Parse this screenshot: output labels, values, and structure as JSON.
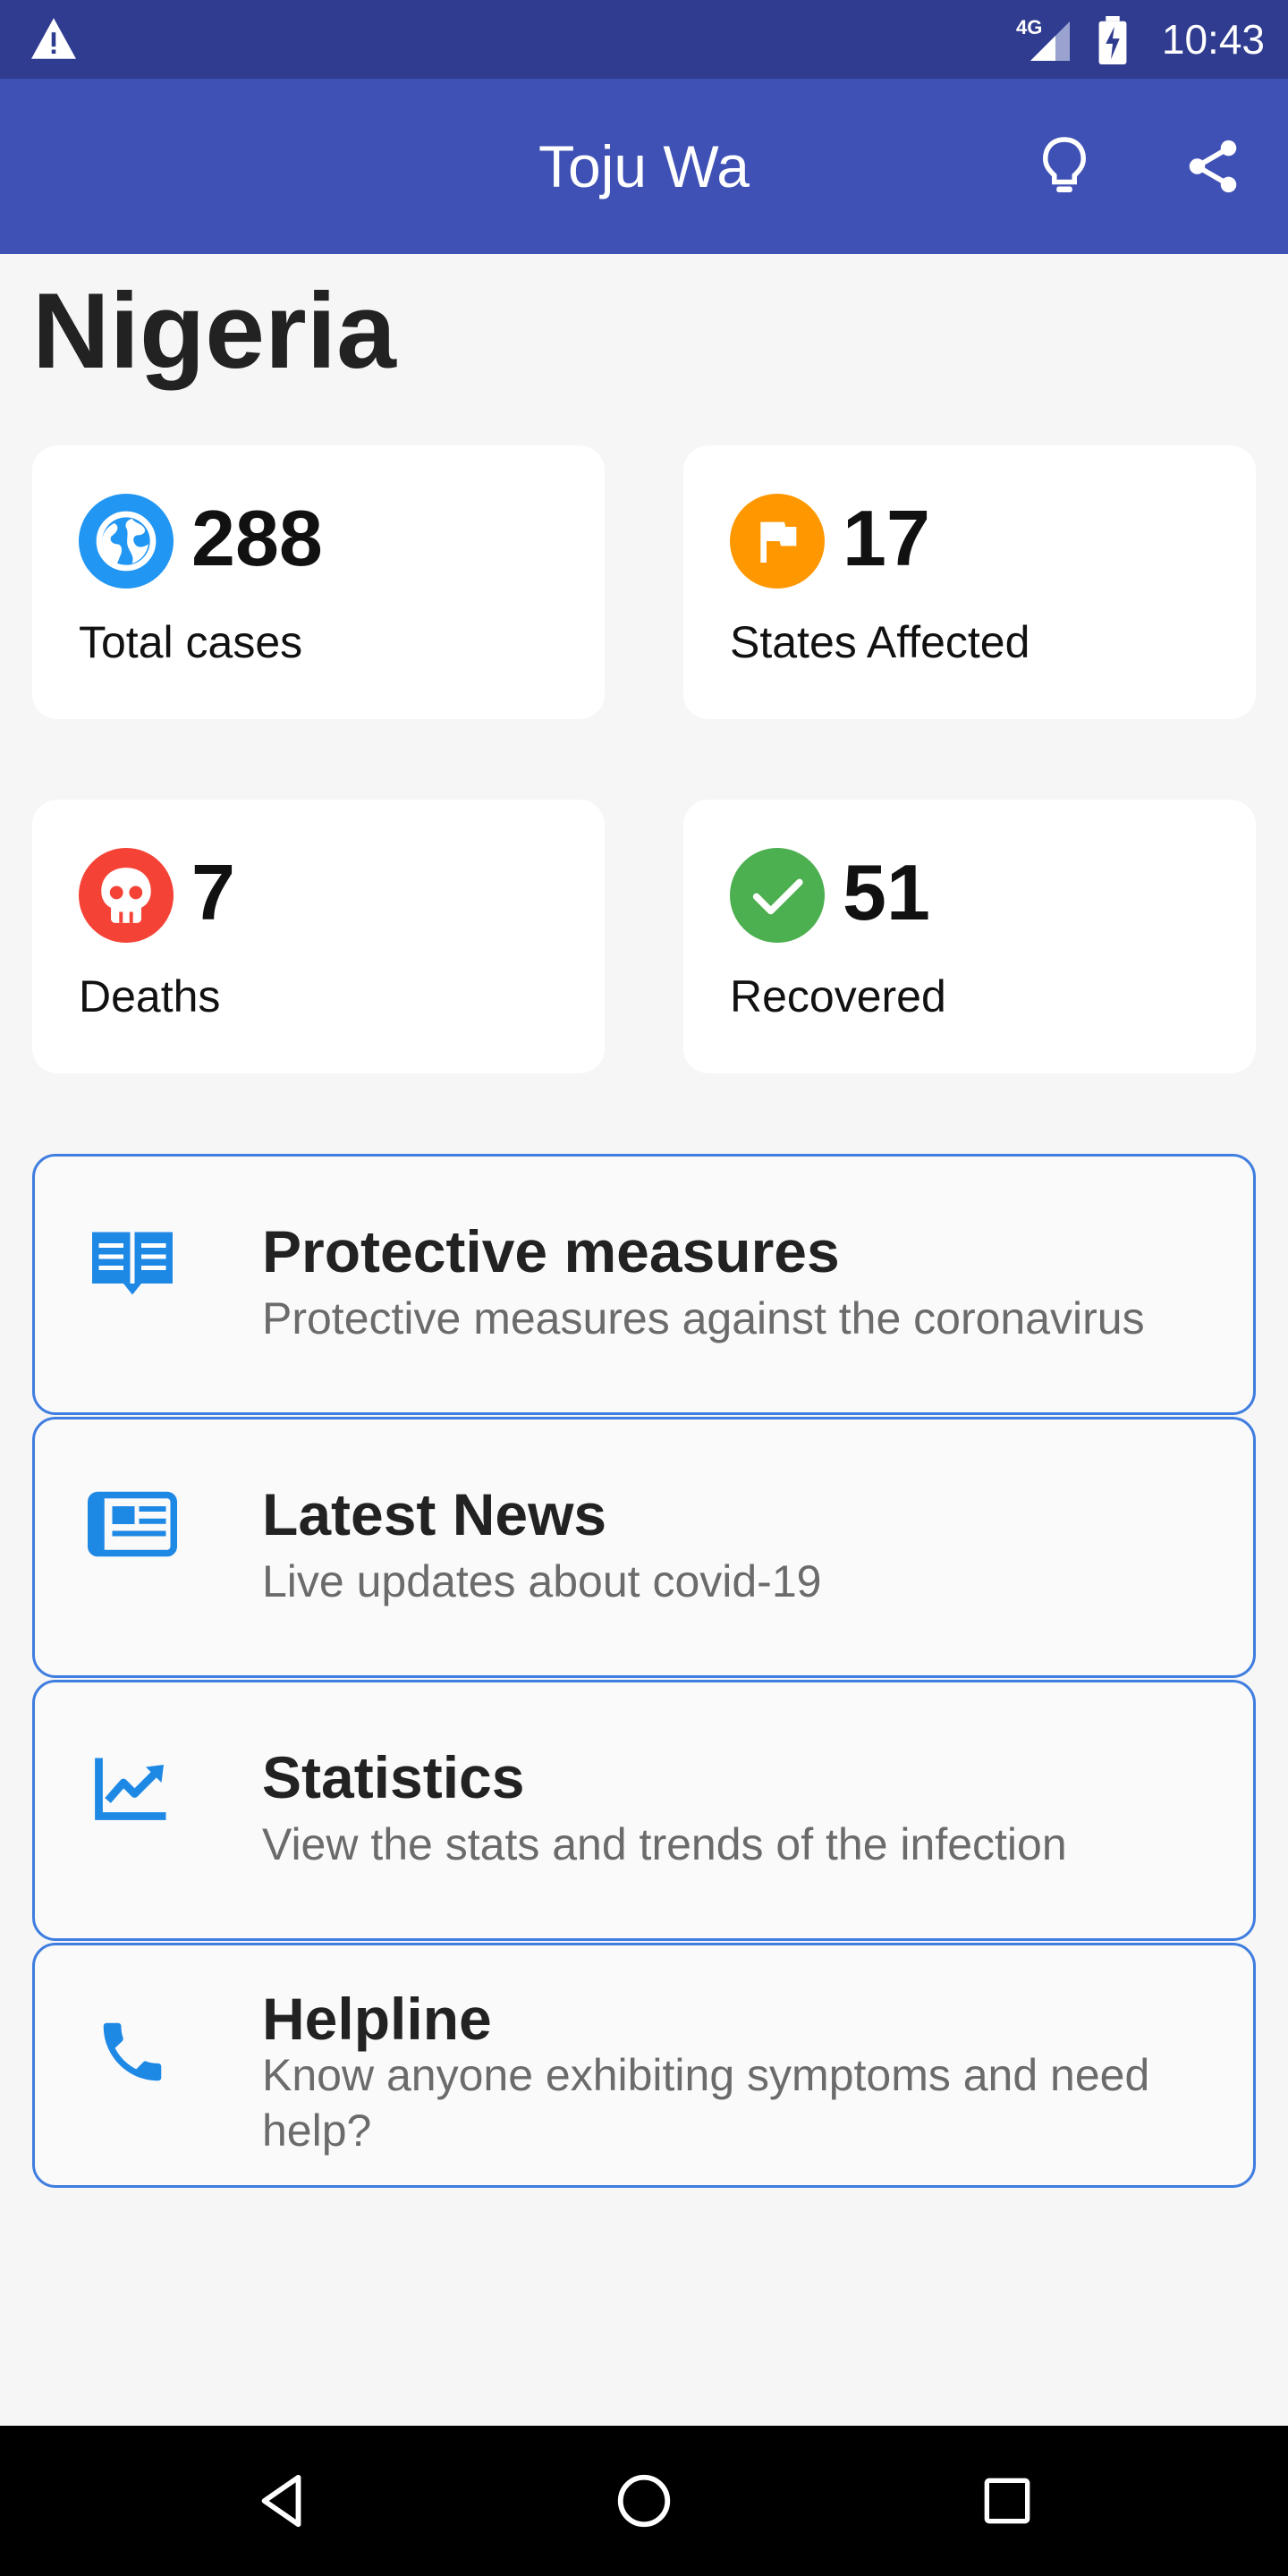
{
  "status_bar": {
    "network_label": "4G",
    "time": "10:43"
  },
  "app_bar": {
    "title": "Toju Wa",
    "actions": [
      "lightbulb-icon",
      "share-icon"
    ]
  },
  "country": "Nigeria",
  "stats": [
    {
      "value": "288",
      "label": "Total cases",
      "icon": "globe-icon",
      "color": "#2196f3"
    },
    {
      "value": "17",
      "label": "States Affected",
      "icon": "flag-icon",
      "color": "#ff9800"
    },
    {
      "value": "7",
      "label": "Deaths",
      "icon": "skull-icon",
      "color": "#f44336"
    },
    {
      "value": "51",
      "label": "Recovered",
      "icon": "check-icon",
      "color": "#4caf50"
    }
  ],
  "menu": [
    {
      "title": "Protective measures",
      "subtitle": "Protective measures against the coronavirus",
      "icon": "book-open-icon"
    },
    {
      "title": "Latest News",
      "subtitle": "Live updates about covid-19",
      "icon": "newspaper-icon"
    },
    {
      "title": "Statistics",
      "subtitle": "View the stats and trends of the infection",
      "icon": "trending-up-icon"
    },
    {
      "title": "Helpline",
      "subtitle": "Know anyone exhibiting symptoms and need help?",
      "icon": "phone-icon"
    }
  ],
  "colors": {
    "status_bar": "#2f3c8f",
    "app_bar": "#3f51b5",
    "accent_icon": "#1e88e5",
    "card_border": "#3f7de0"
  }
}
